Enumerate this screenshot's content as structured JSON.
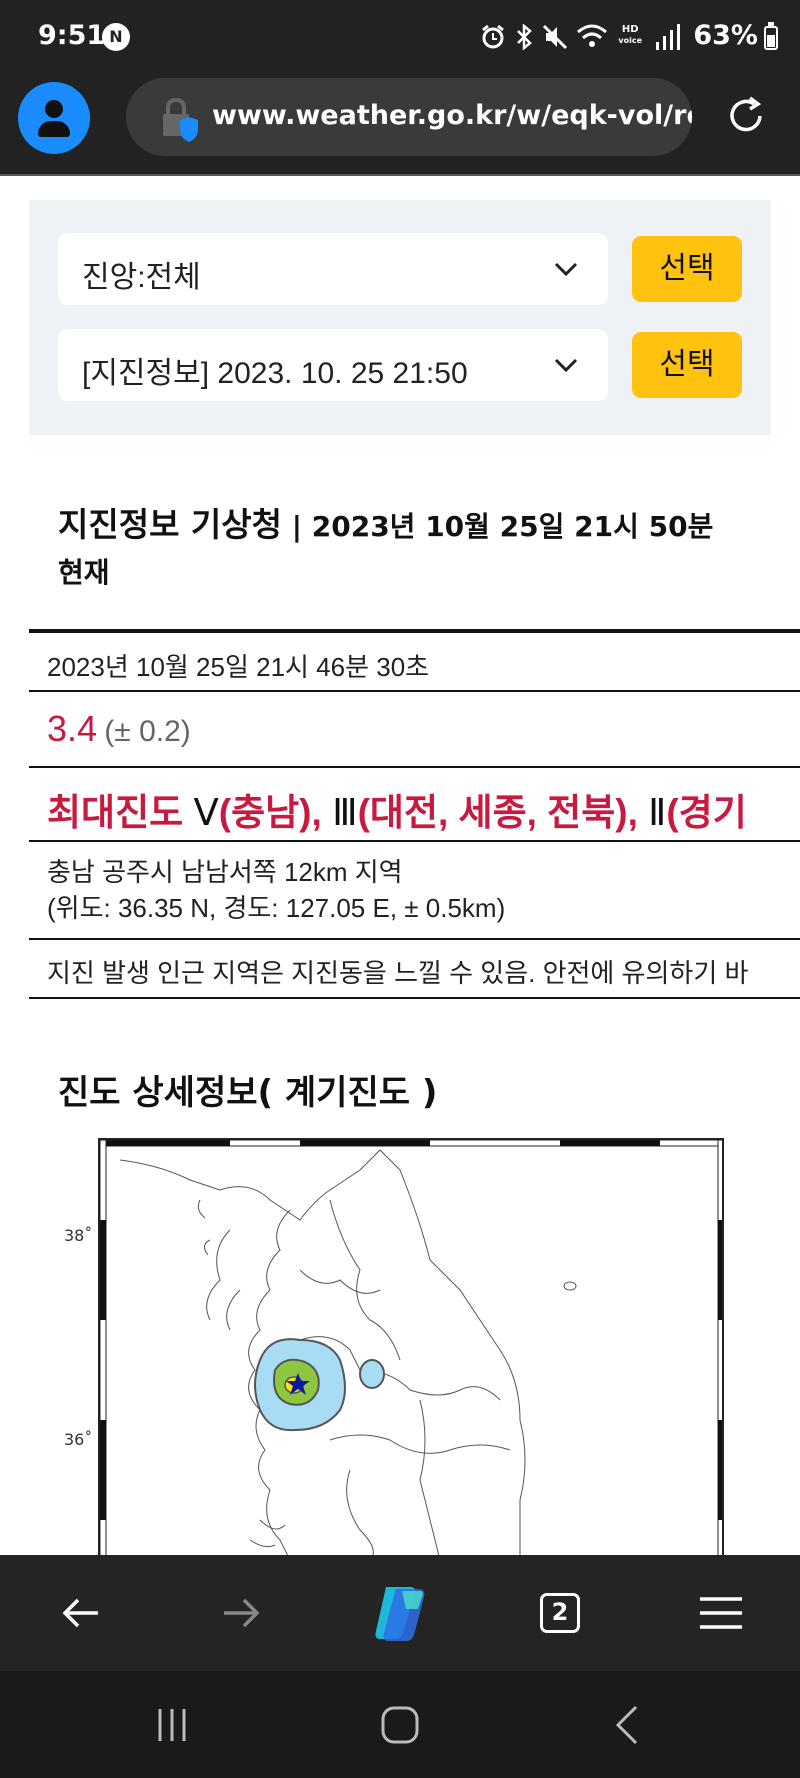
{
  "status_bar": {
    "time": "9:51",
    "notification_badge": "N",
    "hd_label": "HD",
    "voice_label": "voice",
    "battery": "63%",
    "icons": [
      "alarm-icon",
      "bluetooth-icon",
      "mute-icon",
      "wifi-icon",
      "hd-voice-icon",
      "signal-icon",
      "battery-icon"
    ]
  },
  "browser": {
    "url": "www.weather.go.kr/w/eqk-vol/re",
    "icons": [
      "avatar-icon",
      "lock-shield-icon",
      "reload-icon"
    ]
  },
  "selectors": [
    {
      "value": "진앙:전체",
      "button": "선택"
    },
    {
      "value": "[지진정보] 2023. 10. 25 21:50",
      "button": "선택"
    }
  ],
  "report": {
    "title": "지진정보 기상청",
    "separator": " | ",
    "subtitle": "2023년 10월 25일 21시 50분",
    "subtitle_line2": "현재",
    "time": "2023년 10월 25일 21시 46분 30초",
    "magnitude": "3.4",
    "magnitude_range": "(± 0.2)",
    "intensity_label": "최대진도",
    "intensity_v": "Ⅴ",
    "intensity_v_region": "(충남),",
    "intensity_iii": "Ⅲ",
    "intensity_iii_region": "(대전, 세종, 전북),",
    "intensity_ii": "Ⅱ",
    "intensity_ii_region": "(경기",
    "location": "충남 공주시 남남서쪽 12km 지역",
    "coordinates": "(위도: 36.35 N, 경도: 127.05 E, ± 0.5km)",
    "notice": "지진 발생 인근 지역은 지진동을 느낄 수 있음. 안전에 유의하기 바"
  },
  "map": {
    "title": "진도 상세정보( 계기진도 )",
    "lat_labels": [
      "38˚",
      "36˚"
    ],
    "colors": {
      "outer": "#a8dcf4",
      "middle": "#8ec63f",
      "inner": "#f7e11a",
      "epicenter": "#0a1a9e"
    }
  },
  "bottom_nav": {
    "tab_count": "2",
    "icons": [
      "back-arrow-icon",
      "forward-arrow-icon",
      "copilot-icon",
      "tabs-icon",
      "menu-icon"
    ]
  },
  "system_nav": {
    "icons": [
      "recent-apps-icon",
      "home-icon",
      "back-icon"
    ]
  }
}
